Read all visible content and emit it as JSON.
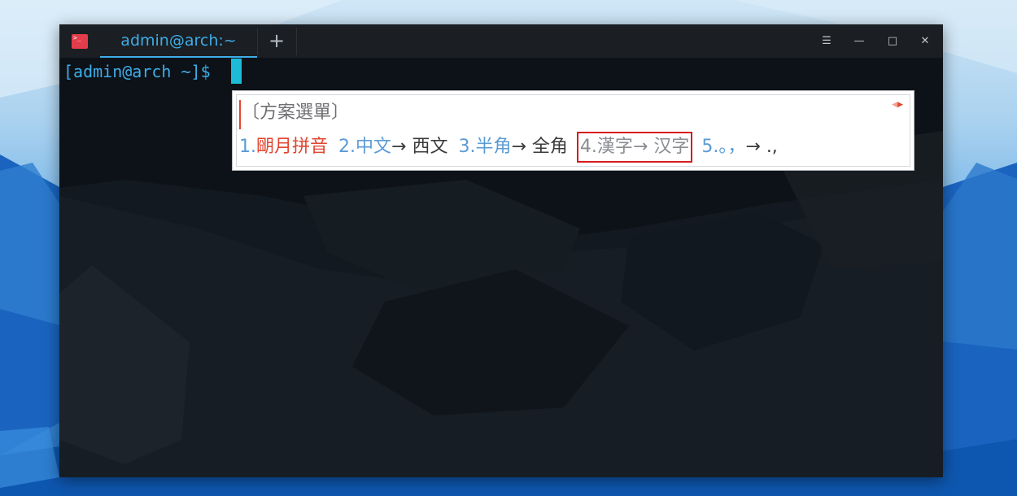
{
  "window": {
    "tab_title": "admin@arch:~",
    "new_tab_symbol": "+",
    "app_icon_glyph": ">_",
    "controls": {
      "menu": "☰",
      "minimize": "—",
      "maximize": "□",
      "close": "✕"
    }
  },
  "terminal": {
    "prompt": "[admin@arch ~]$"
  },
  "ime": {
    "title": "〔方案選單〕",
    "arrows": {
      "prev": "◀",
      "next": "▶"
    },
    "candidates": [
      {
        "num": "1.",
        "text": "朙月拼音",
        "tail": ""
      },
      {
        "num": "2.",
        "text": "中文",
        "tail": "→  西文"
      },
      {
        "num": "3.",
        "text": "半角",
        "tail": "→  全角"
      },
      {
        "num": "4.",
        "text": "漢字",
        "tail": "→  汉字"
      },
      {
        "num": "5.",
        "text": "。，",
        "tail": "→  .,"
      }
    ]
  },
  "colors": {
    "accent_blue": "#3daee9",
    "highlight_red": "#e2452f",
    "candidate_blue": "#5b9bd5",
    "box_red": "#d91a1a"
  }
}
